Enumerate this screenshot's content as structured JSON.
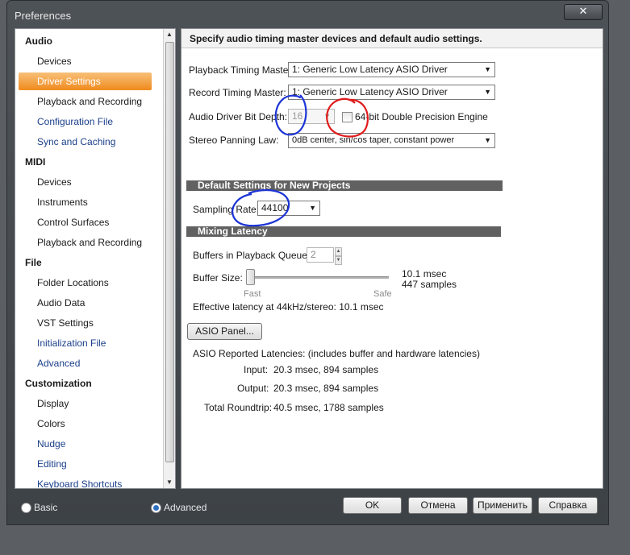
{
  "window": {
    "title": "Preferences",
    "close_label": "✕"
  },
  "sidebar": {
    "items": [
      {
        "label": "Audio"
      },
      {
        "label": "Devices"
      },
      {
        "label": "Driver Settings"
      },
      {
        "label": "Playback and Recording"
      },
      {
        "label": "Configuration File"
      },
      {
        "label": "Sync and Caching"
      },
      {
        "label": "MIDI"
      },
      {
        "label": "Devices"
      },
      {
        "label": "Instruments"
      },
      {
        "label": "Control Surfaces"
      },
      {
        "label": "Playback and Recording"
      },
      {
        "label": "File"
      },
      {
        "label": "Folder Locations"
      },
      {
        "label": "Audio Data"
      },
      {
        "label": "VST Settings"
      },
      {
        "label": "Initialization File"
      },
      {
        "label": "Advanced"
      },
      {
        "label": "Customization"
      },
      {
        "label": "Display"
      },
      {
        "label": "Colors"
      },
      {
        "label": "Nudge"
      },
      {
        "label": "Editing"
      },
      {
        "label": "Keyboard Shortcuts"
      }
    ]
  },
  "content": {
    "header": "Specify audio timing master devices and default audio settings.",
    "playback_master": {
      "label": "Playback Timing Master:",
      "value": "1: Generic Low Latency ASIO Driver"
    },
    "record_master": {
      "label": "Record Timing Master:",
      "value": "1: Generic Low Latency ASIO Driver"
    },
    "bit_depth": {
      "label": "Audio Driver Bit Depth:",
      "value": "16"
    },
    "precision": {
      "label_a": "64-bit",
      "label_b": "Double Precision Engine",
      "checked": false
    },
    "panning": {
      "label": "Stereo Panning Law:",
      "value": "0dB center, sin/cos taper, constant power"
    },
    "defaults_section": "Default Settings for New Projects",
    "sampling": {
      "label": "Sampling Rate:",
      "value": "44100"
    },
    "latency_section": "Mixing Latency",
    "buffers": {
      "label": "Buffers in Playback Queue:",
      "value": "2"
    },
    "buffer_size": {
      "label": "Buffer Size:",
      "fast": "Fast",
      "safe": "Safe",
      "msec": "10.1 msec",
      "samples": "447 samples",
      "level": 0.0
    },
    "effective": "Effective latency at 44kHz/stereo:  10.1 msec",
    "asio_button": "ASIO Panel...",
    "reported": "ASIO Reported Latencies: (includes buffer and hardware latencies)",
    "input": {
      "label": "Input:",
      "value": "20.3 msec, 894 samples"
    },
    "output": {
      "label": "Output:",
      "value": "20.3 msec, 894 samples"
    },
    "roundtrip": {
      "label": "Total Roundtrip:",
      "value": "40.5 msec, 1788 samples"
    }
  },
  "footer": {
    "basic": "Basic",
    "advanced": "Advanced",
    "ok": "OK",
    "cancel": "Отмена",
    "apply": "Применить",
    "help": "Справка"
  },
  "colors": {
    "selection": "#f08a1e",
    "annotation_blue": "#1d34d6",
    "annotation_red": "#e01b1b"
  }
}
